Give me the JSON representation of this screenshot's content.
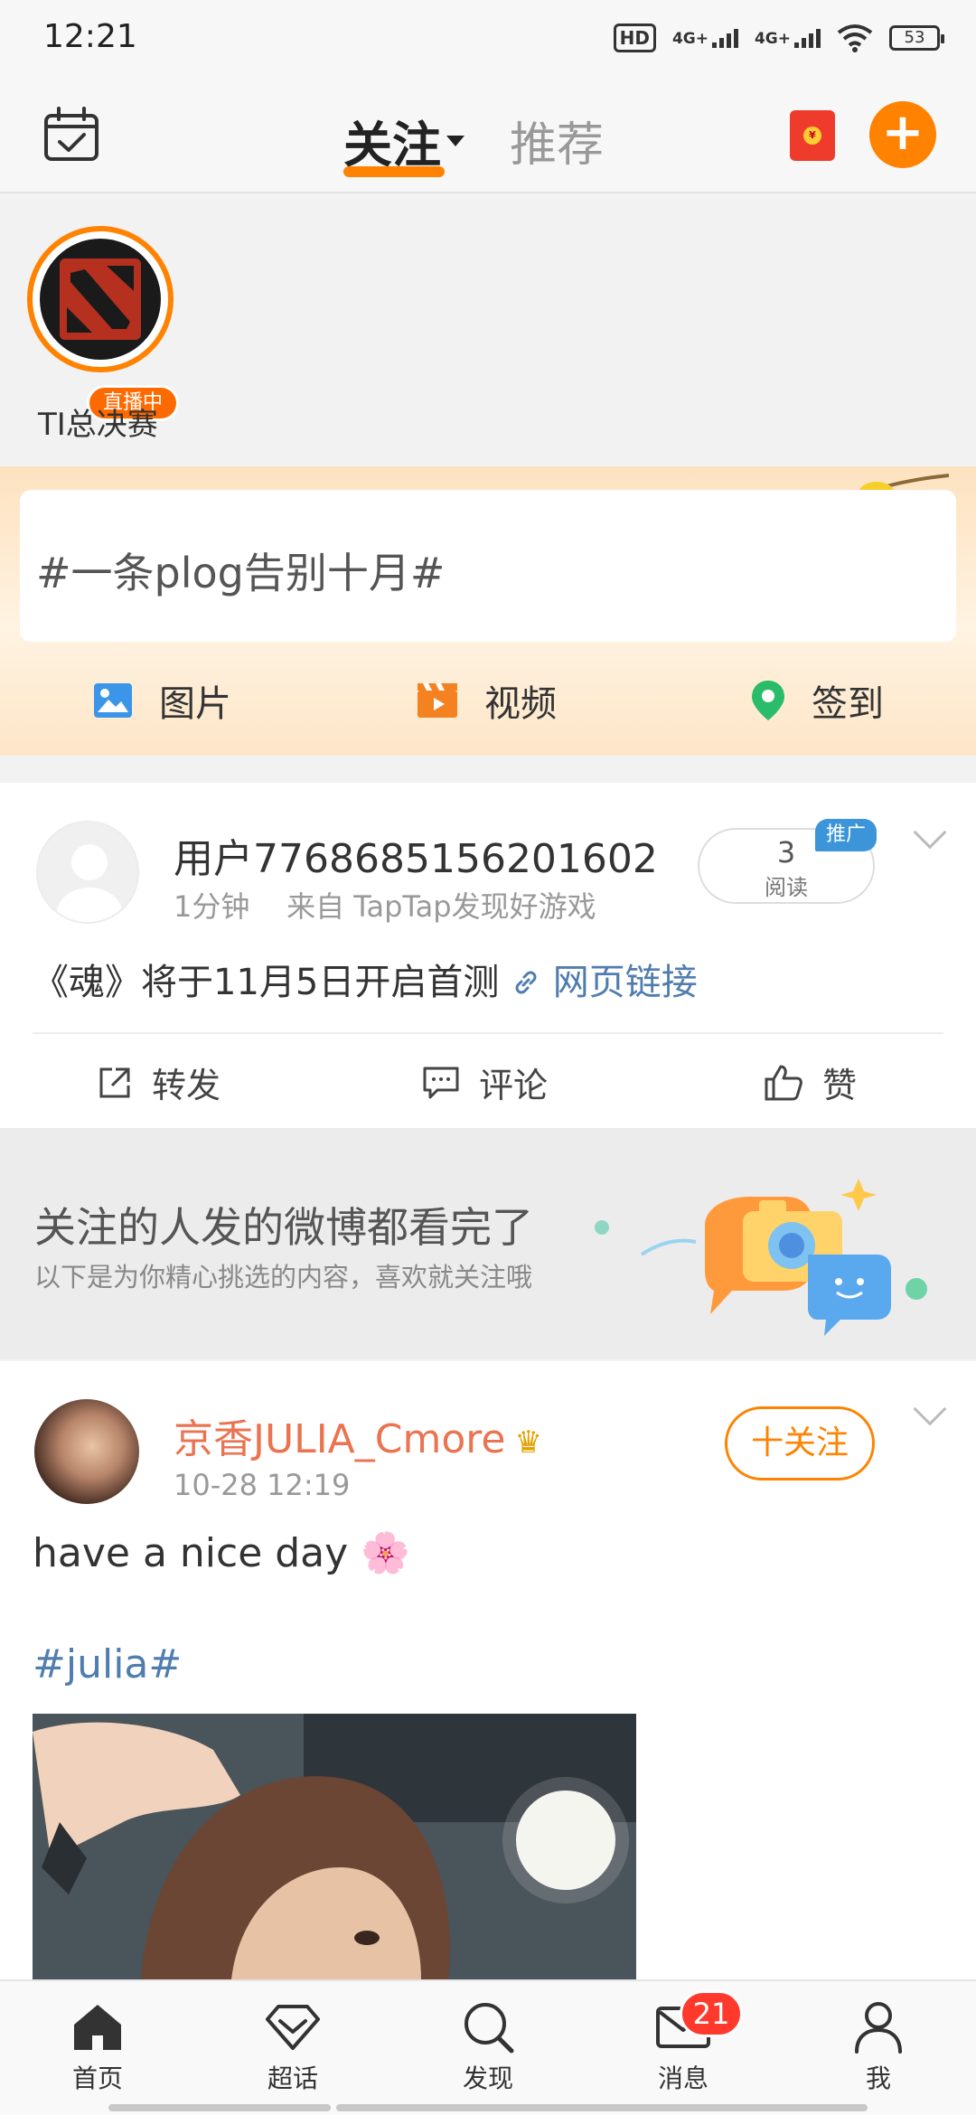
{
  "status_bar": {
    "time": "12:21",
    "hd": "HD",
    "net1": "4G+",
    "net2": "4G+",
    "battery": "53"
  },
  "top_nav": {
    "tab_follow": "关注",
    "tab_recommend": "推荐",
    "compose_symbol": "+",
    "accent_color": "#ff8200"
  },
  "live": {
    "badge": "直播中",
    "name": "TI总决赛"
  },
  "topic_banner": {
    "topic": "#一条plog告别十月#",
    "actions": [
      {
        "label": "图片",
        "icon": "image-icon"
      },
      {
        "label": "视频",
        "icon": "video-icon"
      },
      {
        "label": "签到",
        "icon": "location-pin-icon"
      }
    ]
  },
  "post1": {
    "user": "用户7768685156201602",
    "time": "1分钟",
    "source": "来自 TapTap发现好游戏",
    "read_count": "3",
    "read_label": "阅读",
    "promo_badge": "推广",
    "text": "《魂》将于11月5日开启首测",
    "link": "网页链接",
    "actions": {
      "repost": "转发",
      "comment": "评论",
      "like": "赞"
    }
  },
  "done_banner": {
    "title": "关注的人发的微博都看完了",
    "subtitle": "以下是为你精心挑选的内容，喜欢就关注哦"
  },
  "post2": {
    "user": "京香JULIA_Cmore",
    "time": "10-28 12:19",
    "follow_label": "十关注",
    "text": "have a nice day 🌸",
    "tag": "#julia#"
  },
  "tab_bar": {
    "items": [
      {
        "label": "首页",
        "icon": "home-icon"
      },
      {
        "label": "超话",
        "icon": "diamond-icon"
      },
      {
        "label": "发现",
        "icon": "search-icon"
      },
      {
        "label": "消息",
        "icon": "mail-icon"
      },
      {
        "label": "我",
        "icon": "profile-icon"
      }
    ],
    "message_badge": "21"
  }
}
